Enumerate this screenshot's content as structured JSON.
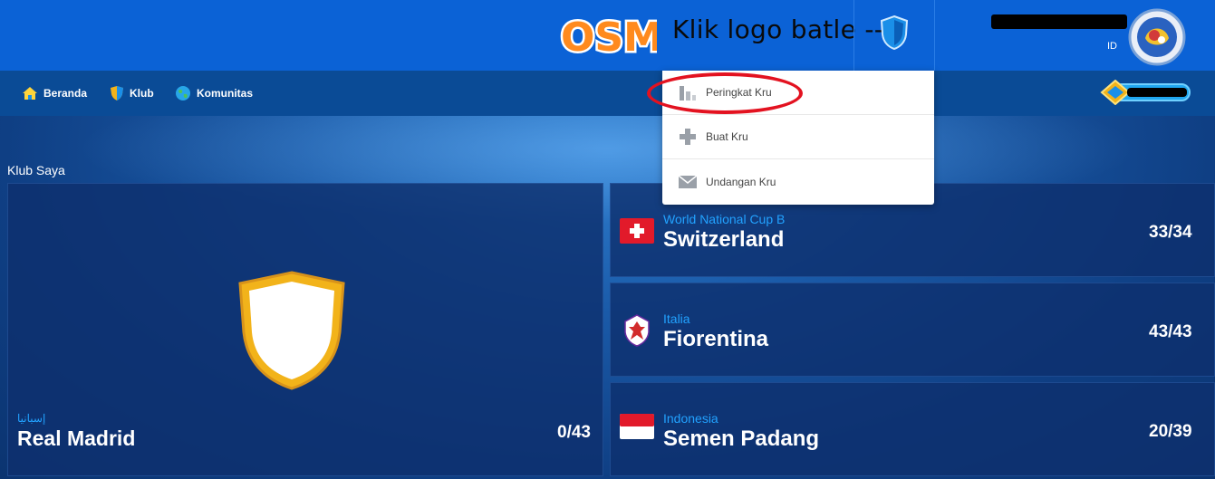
{
  "header": {
    "logo_text": "OSM",
    "annotation": "Klik logo batle -->",
    "user_id_label": "ID"
  },
  "nav": {
    "items": [
      {
        "label": "Beranda",
        "icon": "home-icon"
      },
      {
        "label": "Klub",
        "icon": "shield-icon"
      },
      {
        "label": "Komunitas",
        "icon": "globe-icon"
      }
    ]
  },
  "dropdown": {
    "items": [
      {
        "label": "Peringkat Kru",
        "icon": "bar-chart-icon"
      },
      {
        "label": "Buat Kru",
        "icon": "plus-icon"
      },
      {
        "label": "Undangan Kru",
        "icon": "envelope-icon"
      }
    ]
  },
  "section": {
    "title": "Klub Saya"
  },
  "clubs": {
    "main": {
      "league": "إسبانيا",
      "team": "Real Madrid",
      "score": "0/43"
    },
    "side": [
      {
        "league": "World National Cup B",
        "team": "Switzerland",
        "score": "33/34"
      },
      {
        "league": "Italia",
        "team": "Fiorentina",
        "score": "43/43"
      },
      {
        "league": "Indonesia",
        "team": "Semen Padang",
        "score": "20/39"
      }
    ]
  },
  "colors": {
    "header_blue": "#0b62d6",
    "nav_blue": "#0a4b96",
    "league_blue": "#22a2ff",
    "annotation_red": "#e31220",
    "shield_gold": "#f2b31a"
  }
}
